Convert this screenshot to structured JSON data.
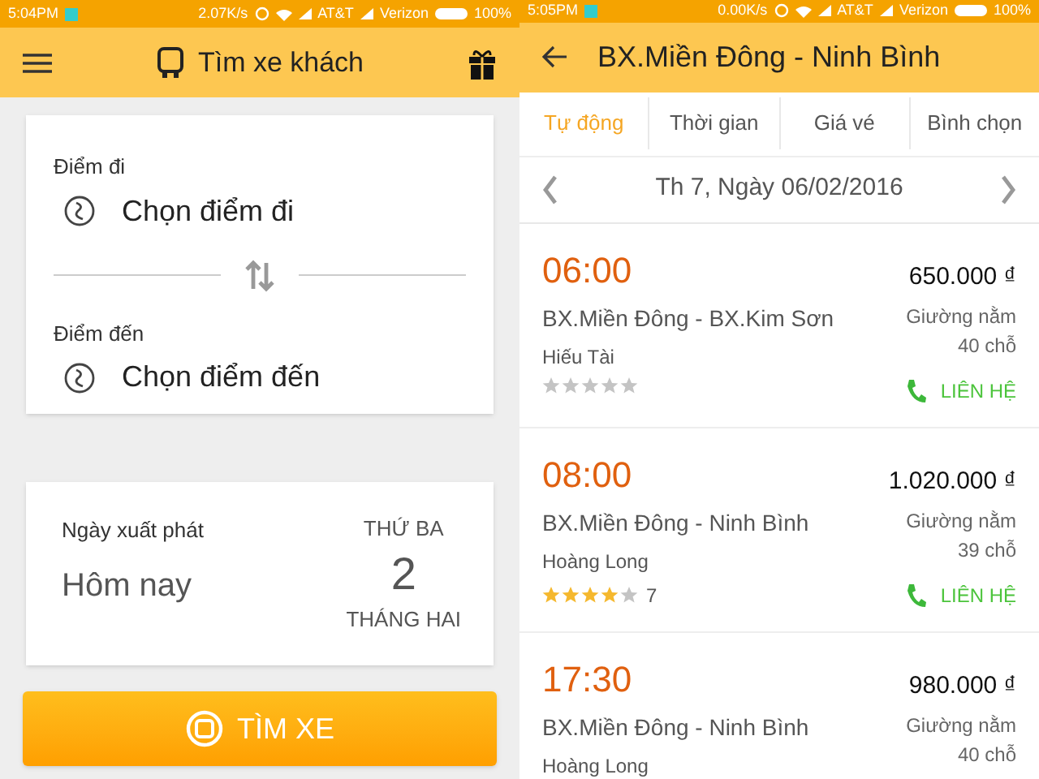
{
  "screens": [
    {
      "status_bar": {
        "time": "5:04PM",
        "speed": "2.07K/s",
        "carrier_1": "AT&T",
        "carrier_2": "Verizon",
        "battery": "100%"
      },
      "app_bar": {
        "title": "Tìm xe khách"
      },
      "route_card": {
        "from_label": "Điểm đi",
        "from_value": "Chọn điểm đi",
        "to_label": "Điểm đến",
        "to_value": "Chọn điểm đến"
      },
      "date_card": {
        "label": "Ngày xuất phát",
        "value": "Hôm nay",
        "weekday": "THỨ BA",
        "day": "2",
        "month": "THÁNG HAI"
      },
      "search_button": "TÌM XE"
    },
    {
      "status_bar": {
        "time": "5:05PM",
        "speed": "0.00K/s",
        "carrier_1": "AT&T",
        "carrier_2": "Verizon",
        "battery": "100%"
      },
      "app_bar": {
        "title": "BX.Miền Đông - Ninh Bình"
      },
      "tabs": [
        {
          "label": "Tự động",
          "selected": true
        },
        {
          "label": "Thời gian",
          "selected": false
        },
        {
          "label": "Giá vé",
          "selected": false
        },
        {
          "label": "Bình chọn",
          "selected": false
        }
      ],
      "date_nav": {
        "label": "Th 7, Ngày 06/02/2016"
      },
      "trips": [
        {
          "time": "06:00",
          "route": "BX.Miền Đông - BX.Kim Sơn",
          "operator": "Hiếu Tài",
          "stars": 0,
          "price": "650.000 ₫",
          "seat_type": "Giường nằm",
          "seats": "40 chỗ",
          "contact": "LIÊN HỆ"
        },
        {
          "time": "08:00",
          "route": "BX.Miền Đông - Ninh Bình",
          "operator": "Hoàng Long",
          "stars": 4,
          "rating_count": "7",
          "price": "1.020.000 ₫",
          "seat_type": "Giường nằm",
          "seats": "39 chỗ",
          "contact": "LIÊN HỆ"
        },
        {
          "time": "17:30",
          "route": "BX.Miền Đông - Ninh Bình",
          "operator": "Hoàng Long",
          "price": "980.000 ₫",
          "seat_type": "Giường nằm",
          "seats": "40 chỗ"
        }
      ]
    }
  ]
}
